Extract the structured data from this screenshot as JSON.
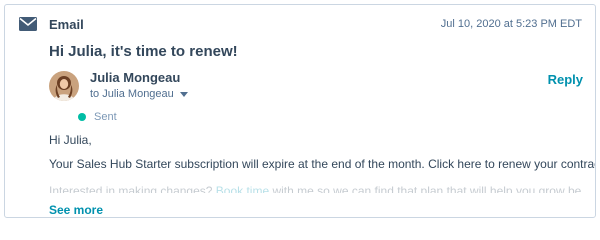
{
  "activity": {
    "type_label": "Email",
    "timestamp": "Jul 10, 2020 at 5:23 PM EDT",
    "icon": "envelope-icon"
  },
  "email": {
    "subject": "Hi Julia, it's time to renew!",
    "sender_name": "Julia Mongeau",
    "recipient": "to Julia Mongeau",
    "status": "Sent",
    "status_color": "#00bda5",
    "reply_label": "Reply",
    "greeting": "Hi Julia,",
    "body_line": "Your Sales Hub Starter subscription will expire at the end of the month. Click here to renew your contract.",
    "faded_line_start": "Interested in making changes? ",
    "faded_link": "Book time",
    "faded_line_end": " with me so we can find that plan that will help you grow better.",
    "see_more_label": "See more"
  },
  "colors": {
    "accent": "#0091ae",
    "text": "#33475b",
    "muted": "#516f90",
    "border": "#cbd6e2"
  }
}
